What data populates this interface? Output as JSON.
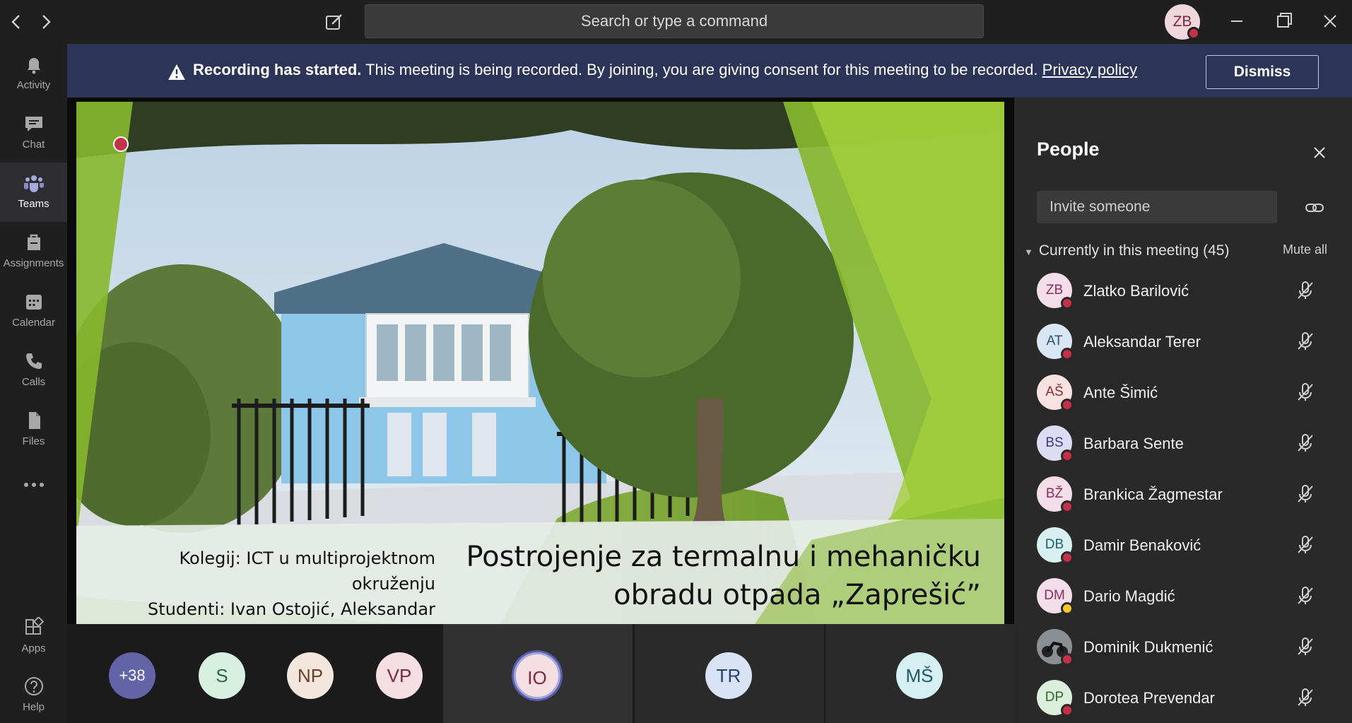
{
  "titlebar": {
    "search_placeholder": "Search or type a command",
    "me_initials": "ZB"
  },
  "rail": {
    "items": [
      {
        "label": "Activity",
        "icon": "bell-icon"
      },
      {
        "label": "Chat",
        "icon": "chat-icon"
      },
      {
        "label": "Teams",
        "icon": "teams-icon"
      },
      {
        "label": "Assignments",
        "icon": "assignments-icon"
      },
      {
        "label": "Calendar",
        "icon": "calendar-icon"
      },
      {
        "label": "Calls",
        "icon": "phone-icon"
      },
      {
        "label": "Files",
        "icon": "files-icon"
      },
      {
        "label": "Apps",
        "icon": "apps-icon"
      },
      {
        "label": "Help",
        "icon": "help-icon"
      }
    ]
  },
  "banner": {
    "bold": "Recording has started.",
    "text": " This meeting is being recorded. By joining, you are giving consent for this meeting to be recorded. ",
    "link": "Privacy policy",
    "dismiss": "Dismiss"
  },
  "slide": {
    "caption_line1": "Kolegij: ICT u multiprojektnom okruženju",
    "caption_line2": "Studenti: Ivan Ostojić, Aleksandar Terer",
    "title_line1": "Postrojenje za termalnu i mehaničku",
    "title_line2": "obradu otpada „Zaprešić”"
  },
  "strip": {
    "overflow": "+38",
    "pills": [
      "S",
      "NP",
      "VP"
    ],
    "tiles": [
      "IO",
      "TR",
      "MŠ"
    ]
  },
  "people": {
    "title": "People",
    "invite_placeholder": "Invite someone",
    "section_label": "Currently in this meeting (45)",
    "mute_all": "Mute all",
    "participants": [
      {
        "initials": "ZB",
        "name": "Zlatko Barilović"
      },
      {
        "initials": "AT",
        "name": "Aleksandar Terer"
      },
      {
        "initials": "AŠ",
        "name": "Ante Šimić"
      },
      {
        "initials": "BS",
        "name": "Barbara Sente"
      },
      {
        "initials": "BŽ",
        "name": "Brankica Žagmestar"
      },
      {
        "initials": "DB",
        "name": "Damir Benaković"
      },
      {
        "initials": "DM",
        "name": "Dario Magdić"
      },
      {
        "initials": "",
        "name": "Dominik Dukmenić"
      },
      {
        "initials": "DP",
        "name": "Dorotea Prevendar"
      }
    ]
  },
  "colors": {
    "banner_bg": "#2c3557",
    "busy_red": "#c4314b",
    "away_yellow": "#f8c62c",
    "accent": "#6264a7"
  }
}
